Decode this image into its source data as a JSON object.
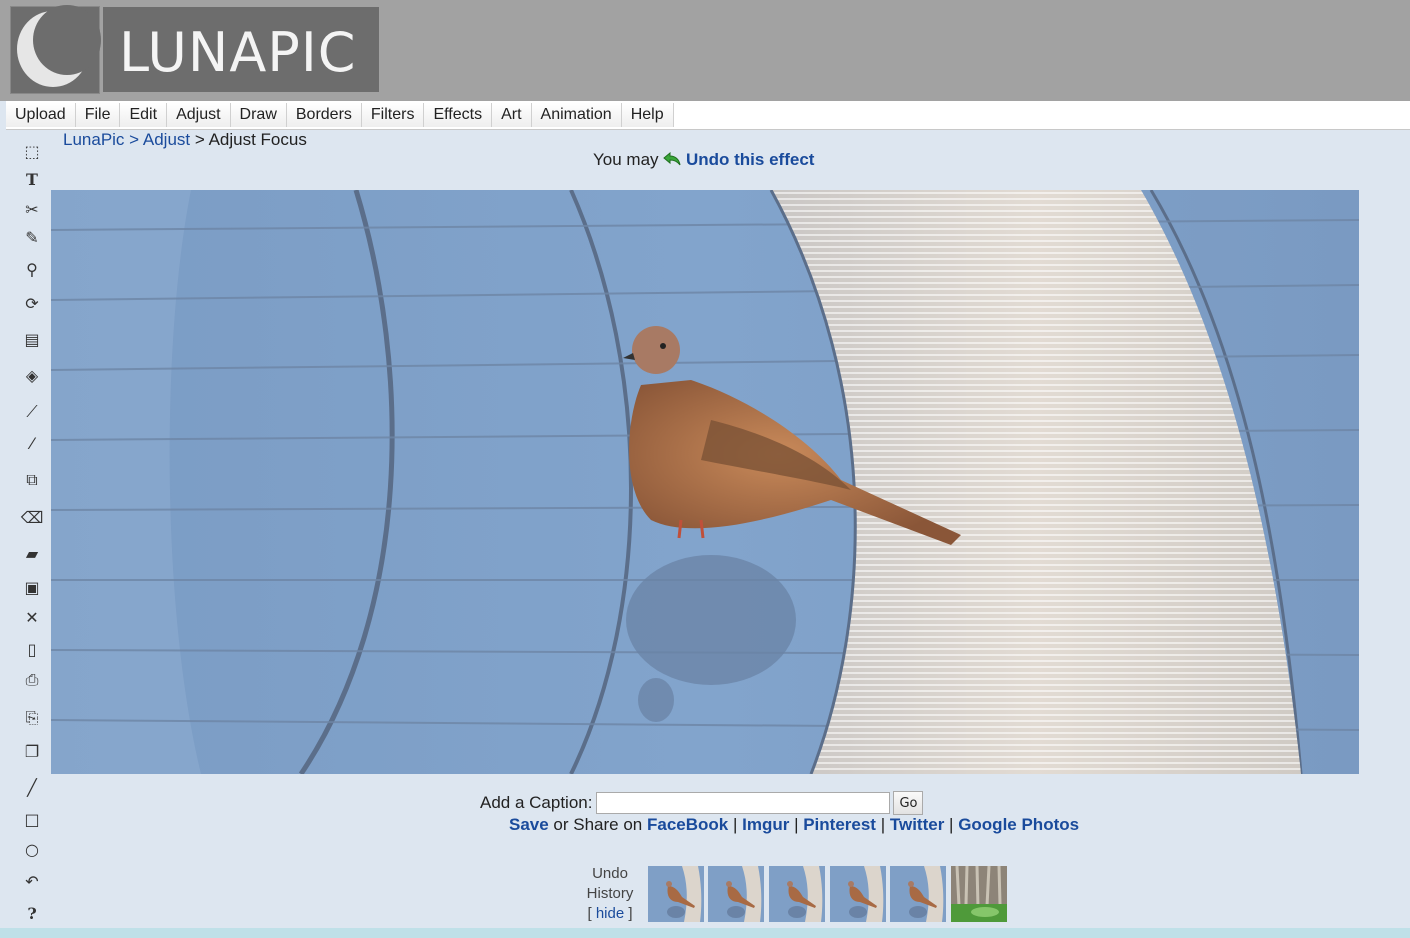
{
  "app": {
    "logo_text": "LUNAPIC"
  },
  "menu": [
    "Upload",
    "File",
    "Edit",
    "Adjust",
    "Draw",
    "Borders",
    "Filters",
    "Effects",
    "Art",
    "Animation",
    "Help"
  ],
  "toolbar": [
    {
      "name": "select-icon",
      "glyph": "⬚"
    },
    {
      "name": "text-icon",
      "glyph": "T"
    },
    {
      "name": "scissors-icon",
      "glyph": "✂"
    },
    {
      "name": "pencil-icon",
      "glyph": "✎"
    },
    {
      "name": "zoom-icon",
      "glyph": "⚲"
    },
    {
      "name": "rotate-icon",
      "glyph": "⟳"
    },
    {
      "name": "gradient-icon",
      "glyph": "▤"
    },
    {
      "name": "paint-bucket-icon",
      "glyph": "◈"
    },
    {
      "name": "eyedropper-icon",
      "glyph": "⟋"
    },
    {
      "name": "brush-icon",
      "glyph": "⁄"
    },
    {
      "name": "crop-icon",
      "glyph": "⧉"
    },
    {
      "name": "eraser-icon",
      "glyph": "⌫"
    },
    {
      "name": "open-folder-icon",
      "glyph": "▰"
    },
    {
      "name": "save-icon",
      "glyph": "▣"
    },
    {
      "name": "close-icon",
      "glyph": "✕"
    },
    {
      "name": "new-file-icon",
      "glyph": "▯"
    },
    {
      "name": "print-icon",
      "glyph": "⎙"
    },
    {
      "name": "paste-icon",
      "glyph": "⎘"
    },
    {
      "name": "copy-icon",
      "glyph": "❐"
    },
    {
      "name": "line-icon",
      "glyph": "╱"
    },
    {
      "name": "rectangle-icon",
      "glyph": "□"
    },
    {
      "name": "circle-icon",
      "glyph": "○"
    },
    {
      "name": "undo-icon",
      "glyph": "↶"
    },
    {
      "name": "help-icon",
      "glyph": "?"
    }
  ],
  "breadcrumb": {
    "home": "LunaPic",
    "sep1": " > ",
    "section": "Adjust",
    "sep2": " > ",
    "current": "Adjust Focus"
  },
  "undo_notice": {
    "prefix": "You may ",
    "icon": "undo-arrow-icon",
    "link": "Undo this effect"
  },
  "caption": {
    "label": "Add a Caption:",
    "value": "",
    "placeholder": "",
    "go": "Go"
  },
  "share": {
    "save": "Save",
    "middle": " or Share on ",
    "links": [
      "FaceBook",
      "Imgur",
      "Pinterest",
      "Twitter",
      "Google Photos"
    ],
    "sep": " | "
  },
  "history": {
    "line1": "Undo",
    "line2": "History",
    "open": "[ ",
    "hide": "hide",
    "close": " ]",
    "thumb_count": 6
  },
  "colors": {
    "link": "#1a4b9c",
    "header": "#a2a2a2",
    "background": "#dde6f0",
    "tile_blue": "#7d9fc7",
    "walkway": "#d7d2cc"
  }
}
